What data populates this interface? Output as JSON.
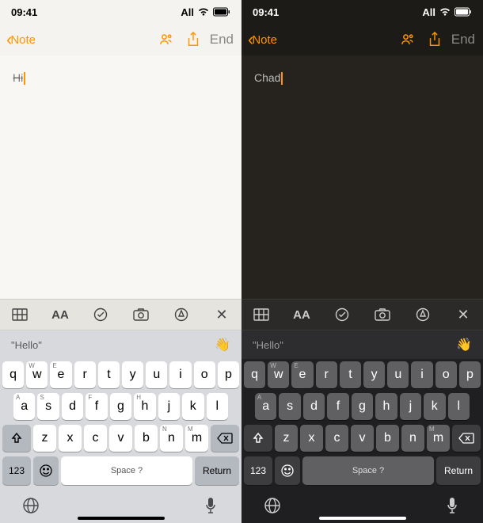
{
  "statusbar": {
    "time": "09:41",
    "carrier": "All"
  },
  "nav": {
    "back_label": "Note",
    "end_label": "End"
  },
  "note": {
    "light_text": "Hi",
    "dark_text": "Chad"
  },
  "suggestion": {
    "text": "\"Hello\"",
    "emoji": "👋"
  },
  "keyboard": {
    "row1": [
      {
        "m": "q",
        "s": ""
      },
      {
        "m": "w",
        "s": "W"
      },
      {
        "m": "e",
        "s": "E"
      },
      {
        "m": "r",
        "s": ""
      },
      {
        "m": "t",
        "s": ""
      },
      {
        "m": "y",
        "s": ""
      },
      {
        "m": "u",
        "s": ""
      },
      {
        "m": "i",
        "s": ""
      },
      {
        "m": "o",
        "s": ""
      },
      {
        "m": "p",
        "s": ""
      }
    ],
    "row2": [
      {
        "m": "a",
        "s": "A"
      },
      {
        "m": "s",
        "s": "S"
      },
      {
        "m": "d",
        "s": ""
      },
      {
        "m": "f",
        "s": "F"
      },
      {
        "m": "g",
        "s": ""
      },
      {
        "m": "h",
        "s": "H"
      },
      {
        "m": "j",
        "s": ""
      },
      {
        "m": "k",
        "s": ""
      },
      {
        "m": "l",
        "s": ""
      }
    ],
    "row3": [
      {
        "m": "z",
        "s": ""
      },
      {
        "m": "x",
        "s": ""
      },
      {
        "m": "c",
        "s": ""
      },
      {
        "m": "v",
        "s": ""
      },
      {
        "m": "b",
        "s": ""
      },
      {
        "m": "n",
        "s": "N"
      },
      {
        "m": "m",
        "s": "M"
      }
    ],
    "row2_dark": [
      {
        "m": "a",
        "s": "A"
      },
      {
        "m": "s",
        "s": ""
      },
      {
        "m": "d",
        "s": ""
      },
      {
        "m": "f",
        "s": ""
      },
      {
        "m": "g",
        "s": ""
      },
      {
        "m": "h",
        "s": ""
      },
      {
        "m": "j",
        "s": ""
      },
      {
        "m": "k",
        "s": ""
      },
      {
        "m": "l",
        "s": ""
      }
    ],
    "row3_dark": [
      {
        "m": "z",
        "s": ""
      },
      {
        "m": "x",
        "s": ""
      },
      {
        "m": "c",
        "s": ""
      },
      {
        "m": "v",
        "s": ""
      },
      {
        "m": "b",
        "s": ""
      },
      {
        "m": "n",
        "s": ""
      },
      {
        "m": "m",
        "s": "M"
      }
    ],
    "num_label": "123",
    "space_label": "Space ?",
    "return_label": "Return"
  },
  "toolbar_labels": {
    "aa": "AA"
  }
}
